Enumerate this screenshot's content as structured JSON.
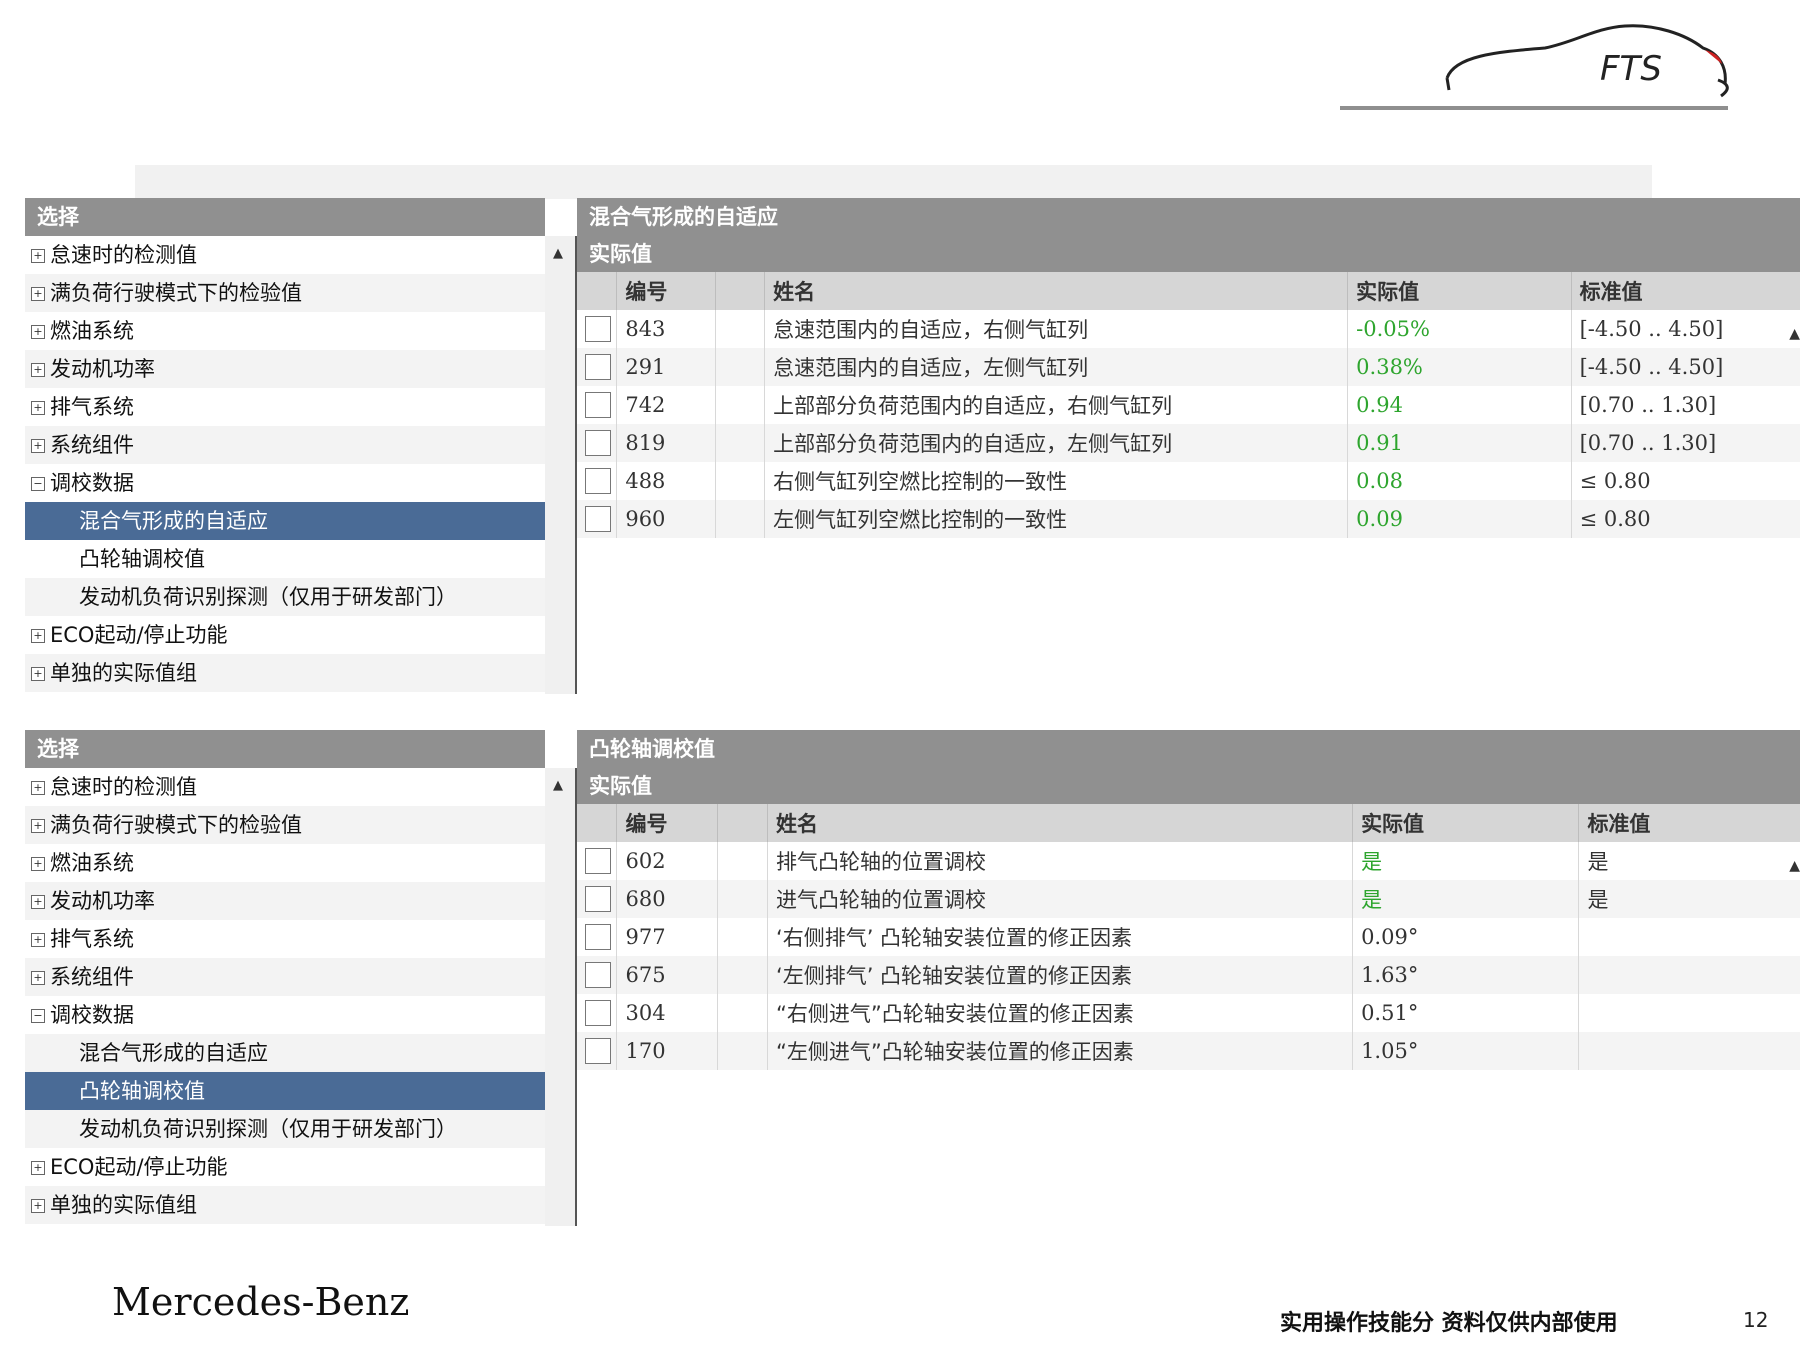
{
  "logo": {
    "text": "FTS"
  },
  "panels": [
    {
      "tree_header": "选择",
      "tree_items": [
        {
          "label": "怠速时的检测值",
          "expander": "+",
          "child": false,
          "selected": false
        },
        {
          "label": "满负荷行驶模式下的检验值",
          "expander": "+",
          "child": false,
          "selected": false
        },
        {
          "label": "燃油系统",
          "expander": "+",
          "child": false,
          "selected": false
        },
        {
          "label": "发动机功率",
          "expander": "+",
          "child": false,
          "selected": false
        },
        {
          "label": "排气系统",
          "expander": "+",
          "child": false,
          "selected": false
        },
        {
          "label": "系统组件",
          "expander": "+",
          "child": false,
          "selected": false
        },
        {
          "label": "调校数据",
          "expander": "−",
          "child": false,
          "selected": false
        },
        {
          "label": "混合气形成的自适应",
          "expander": "",
          "child": true,
          "selected": true
        },
        {
          "label": "凸轮轴调校值",
          "expander": "",
          "child": true,
          "selected": false
        },
        {
          "label": "发动机负荷识别探测（仅用于研发部门）",
          "expander": "",
          "child": true,
          "selected": false
        },
        {
          "label": "ECO起动/停止功能",
          "expander": "+",
          "child": false,
          "selected": false
        },
        {
          "label": "单独的实际值组",
          "expander": "+",
          "child": false,
          "selected": false
        }
      ],
      "title": "混合气形成的自适应",
      "subtitle": "实际值",
      "columns": {
        "id": "编号",
        "name": "姓名",
        "actual": "实际值",
        "standard": "标准值"
      },
      "rows": [
        {
          "id": "843",
          "name": "怠速范围内的自适应，右侧气缸列",
          "actual": "-0.05%",
          "standard": "[-4.50 .. 4.50]"
        },
        {
          "id": "291",
          "name": "怠速范围内的自适应，左侧气缸列",
          "actual": "0.38%",
          "standard": "[-4.50 .. 4.50]"
        },
        {
          "id": "742",
          "name": "上部部分负荷范围内的自适应，右侧气缸列",
          "actual": "0.94",
          "standard": "[0.70 .. 1.30]"
        },
        {
          "id": "819",
          "name": "上部部分负荷范围内的自适应，左侧气缸列",
          "actual": "0.91",
          "standard": "[0.70 .. 1.30]"
        },
        {
          "id": "488",
          "name": "右侧气缸列空燃比控制的一致性",
          "actual": "0.08",
          "standard": "≤ 0.80"
        },
        {
          "id": "960",
          "name": "左侧气缸列空燃比控制的一致性",
          "actual": "0.09",
          "standard": "≤ 0.80"
        }
      ]
    },
    {
      "tree_header": "选择",
      "tree_items": [
        {
          "label": "怠速时的检测值",
          "expander": "+",
          "child": false,
          "selected": false
        },
        {
          "label": "满负荷行驶模式下的检验值",
          "expander": "+",
          "child": false,
          "selected": false
        },
        {
          "label": "燃油系统",
          "expander": "+",
          "child": false,
          "selected": false
        },
        {
          "label": "发动机功率",
          "expander": "+",
          "child": false,
          "selected": false
        },
        {
          "label": "排气系统",
          "expander": "+",
          "child": false,
          "selected": false
        },
        {
          "label": "系统组件",
          "expander": "+",
          "child": false,
          "selected": false
        },
        {
          "label": "调校数据",
          "expander": "−",
          "child": false,
          "selected": false
        },
        {
          "label": "混合气形成的自适应",
          "expander": "",
          "child": true,
          "selected": false
        },
        {
          "label": "凸轮轴调校值",
          "expander": "",
          "child": true,
          "selected": true
        },
        {
          "label": "发动机负荷识别探测（仅用于研发部门）",
          "expander": "",
          "child": true,
          "selected": false
        },
        {
          "label": "ECO起动/停止功能",
          "expander": "+",
          "child": false,
          "selected": false
        },
        {
          "label": "单独的实际值组",
          "expander": "+",
          "child": false,
          "selected": false
        }
      ],
      "title": "凸轮轴调校值",
      "subtitle": "实际值",
      "columns": {
        "id": "编号",
        "name": "姓名",
        "actual": "实际值",
        "standard": "标准值"
      },
      "rows": [
        {
          "id": "602",
          "name": "排气凸轮轴的位置调校",
          "actual": "是",
          "standard": "是"
        },
        {
          "id": "680",
          "name": "进气凸轮轴的位置调校",
          "actual": "是",
          "standard": "是"
        },
        {
          "id": "977",
          "name": "‘右侧排气’ 凸轮轴安装位置的修正因素",
          "actual": "0.09°",
          "standard": ""
        },
        {
          "id": "675",
          "name": "‘左侧排气’ 凸轮轴安装位置的修正因素",
          "actual": "1.63°",
          "standard": ""
        },
        {
          "id": "304",
          "name": "“右侧进气”凸轮轴安装位置的修正因素",
          "actual": "0.51°",
          "standard": ""
        },
        {
          "id": "170",
          "name": "“左侧进气”凸轮轴安装位置的修正因素",
          "actual": "1.05°",
          "standard": ""
        }
      ]
    }
  ],
  "colors": {
    "header_gray": "#909090",
    "selection_blue": "#4a6b96",
    "value_green": "#2ea52e"
  },
  "footer": {
    "brand": "Mercedes-Benz",
    "note": "实用操作技能分 资料仅供内部使用",
    "page": "12"
  }
}
